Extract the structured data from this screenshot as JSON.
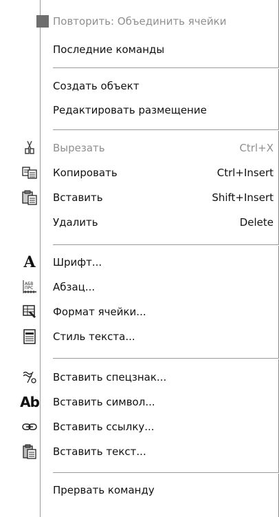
{
  "menu": {
    "items": [
      {
        "label": "Повторить: Объединить ячейки",
        "shortcut": "",
        "icon": "repeat-square-icon",
        "disabled": true
      },
      {
        "label": "Последние команды",
        "shortcut": "",
        "icon": "",
        "disabled": false
      },
      {
        "label": "Создать объект",
        "shortcut": "",
        "icon": "",
        "disabled": false
      },
      {
        "label": "Редактировать размещение",
        "shortcut": "",
        "icon": "",
        "disabled": false
      },
      {
        "label": "Вырезать",
        "shortcut": "Ctrl+X",
        "icon": "scissors-icon",
        "disabled": true
      },
      {
        "label": "Копировать",
        "shortcut": "Ctrl+Insert",
        "icon": "copy-icon",
        "disabled": false
      },
      {
        "label": "Вставить",
        "shortcut": "Shift+Insert",
        "icon": "paste-icon",
        "disabled": false
      },
      {
        "label": "Удалить",
        "shortcut": "Delete",
        "icon": "",
        "disabled": false
      },
      {
        "label": "Шрифт...",
        "shortcut": "",
        "icon": "font-icon",
        "disabled": false
      },
      {
        "label": "Абзац...",
        "shortcut": "",
        "icon": "paragraph-icon",
        "disabled": false
      },
      {
        "label": "Формат ячейки...",
        "shortcut": "",
        "icon": "cell-format-icon",
        "disabled": false
      },
      {
        "label": "Стиль текста...",
        "shortcut": "",
        "icon": "text-style-icon",
        "disabled": false
      },
      {
        "label": "Вставить спецзнак...",
        "shortcut": "",
        "icon": "special-char-icon",
        "disabled": false
      },
      {
        "label": "Вставить символ...",
        "shortcut": "",
        "icon": "symbol-icon",
        "disabled": false
      },
      {
        "label": "Вставить ссылку...",
        "shortcut": "",
        "icon": "link-icon",
        "disabled": false
      },
      {
        "label": "Вставить текст...",
        "shortcut": "",
        "icon": "insert-text-icon",
        "disabled": false
      },
      {
        "label": "Прервать команду",
        "shortcut": "",
        "icon": "",
        "disabled": false
      }
    ]
  }
}
